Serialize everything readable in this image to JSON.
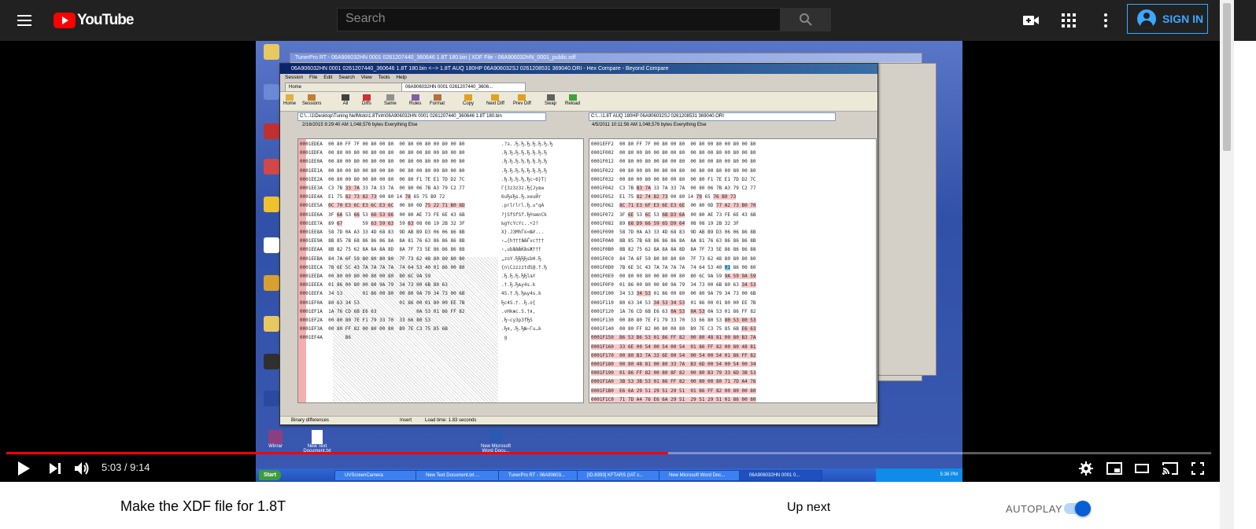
{
  "masthead": {
    "logo_text": "YouTube",
    "search_placeholder": "Search",
    "signin_label": "SIGN IN"
  },
  "player": {
    "progress_fraction": 0.5494,
    "time_current": "5:03",
    "time_total": "9:14",
    "time_separator": " / "
  },
  "screen_content": {
    "bg_window_title": "TunerPro RT - 06A906032HN 0001 0261207440_360646 1.8T 180.bin | XDF File - 06A906032HN_0001_public.xdf",
    "bc_title": "06A906032HN 0001 0261207440_360646 1.8T 180.bin <--> 1.8T AUQ 180HP 06A906032SJ 0261208531 369040.ORI - Hex Compare - Beyond Compare",
    "menu": [
      "Session",
      "File",
      "Edit",
      "Search",
      "View",
      "Tools",
      "Help"
    ],
    "tab_home": "Home",
    "tab_file": "06A906032HN 0001 0261207440_3606...",
    "toolbar": [
      "Home",
      "Sessions",
      "All",
      "Diffs",
      "Same",
      "Rules",
      "Format",
      "Copy",
      "Next Diff",
      "Prev Diff",
      "Swap",
      "Reload"
    ],
    "left_path": "C:\\...\\1\\Desktop\\Tuning NefMoto\\1.8T\\nh\\06A906032HN 0001 0261207440_360646 1.8T 180.bin",
    "right_path": "C:\\...\\1.8T AUQ 180HP 06A906032SJ 0261208531 369040.ORI",
    "left_info": "2/16/2015 9:29:40 AM     1,048,576 bytes     Everything Else",
    "right_info": "4/5/2011 10:11:56 AM     1,048,576 bytes     Everything Else",
    "status": [
      "Binary differences",
      "Insert",
      "Load time: 1.83 seconds"
    ],
    "taskbar_start": "Start",
    "taskbar_items": [
      "UVScreenCamera",
      "New Text Document.txt ...",
      "TunerPro RT - 06A90603...",
      "[ID.8393] KFTARS (IAT c...",
      "New Microsoft Word Doc...",
      "06A906032HN 0001 0..."
    ],
    "tray_time": "5:36 PM",
    "desk_bottom": [
      "Winrar",
      "New Text Document.txt",
      "New Microsoft Word Docu..."
    ]
  },
  "below": {
    "video_title": "Make the XDF file for 1.8T",
    "up_next": "Up next",
    "autoplay": "AUTOPLAY"
  }
}
